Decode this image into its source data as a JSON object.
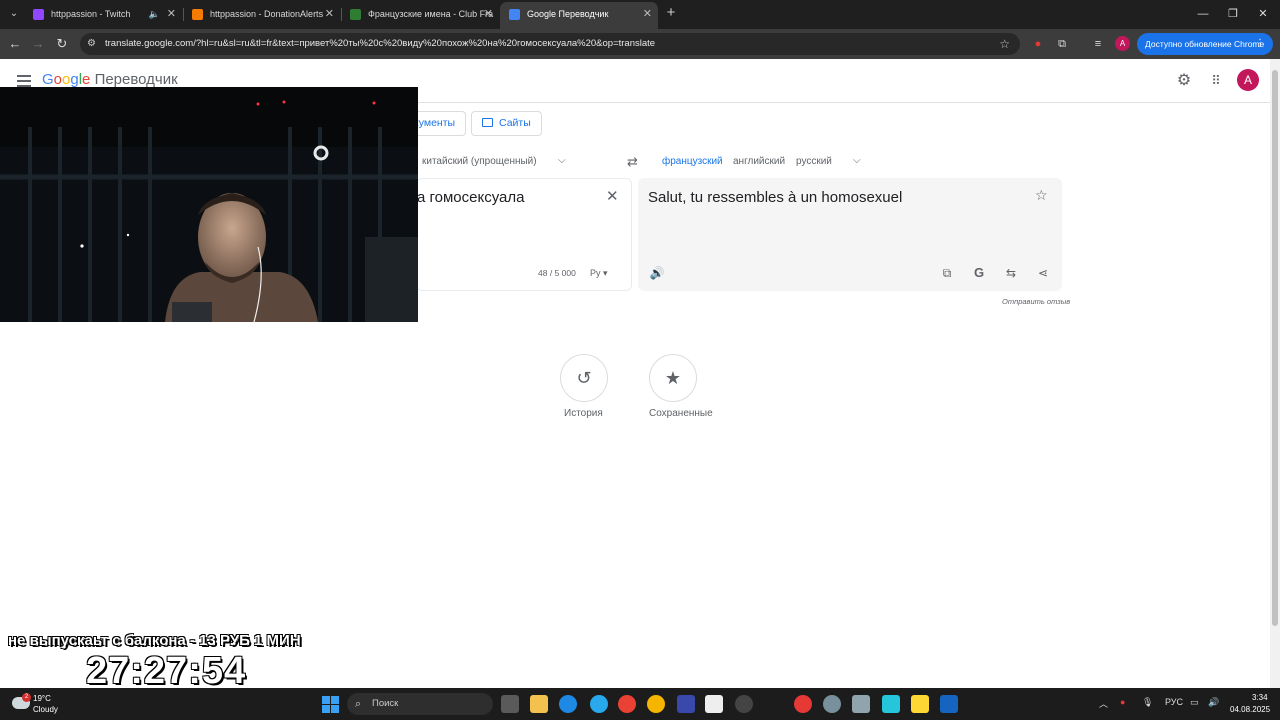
{
  "browser": {
    "tabs": [
      {
        "title": "httppassion - Twitch",
        "favicon_color": "#9146ff",
        "audio": true
      },
      {
        "title": "httppassion - DonationAlerts",
        "favicon_color": "#f57c00",
        "audio": false
      },
      {
        "title": "Французские имена - Club Fra",
        "favicon_color": "#2e7d32",
        "audio": false
      },
      {
        "title": "Google Переводчик",
        "favicon_color": "#4285f4",
        "audio": false,
        "active": true
      }
    ],
    "url": "translate.google.com/?hl=ru&sl=ru&tl=fr&text=привет%20ты%20с%20виду%20похож%20на%20гомосексуала%20&op=translate",
    "profile_initial": "A",
    "update_label": "Доступно обновление Chrome"
  },
  "translate": {
    "logo_google": [
      "G",
      "o",
      "o",
      "g",
      "l",
      "e"
    ],
    "logo_suffix": "Переводчик",
    "mode_documents": "кументы",
    "mode_sites": "Сайты",
    "source_lang": "китайский (упрощенный)",
    "target_langs": [
      "французский",
      "английский",
      "русский"
    ],
    "source_text": "а гомосексуала",
    "char_count": "48 / 5 000",
    "keyboard_label": "Ру",
    "target_text": "Salut, tu ressembles à un homosexuel",
    "feedback_label": "Отправить отзыв",
    "history_label": "История",
    "saved_label": "Сохраненные",
    "avatar_initial": "A",
    "accent_color": "#1a73e8"
  },
  "stream_overlay": {
    "message": "не выпускаьт с балкона - 13 РУБ 1 МИН",
    "timer": "27:27:54"
  },
  "taskbar": {
    "weather_temp": "19°C",
    "weather_desc": "Cloudy",
    "weather_badge": "2",
    "search_placeholder": "Поиск",
    "language": "РУС",
    "time": "3:34",
    "date": "04.08.2025"
  }
}
